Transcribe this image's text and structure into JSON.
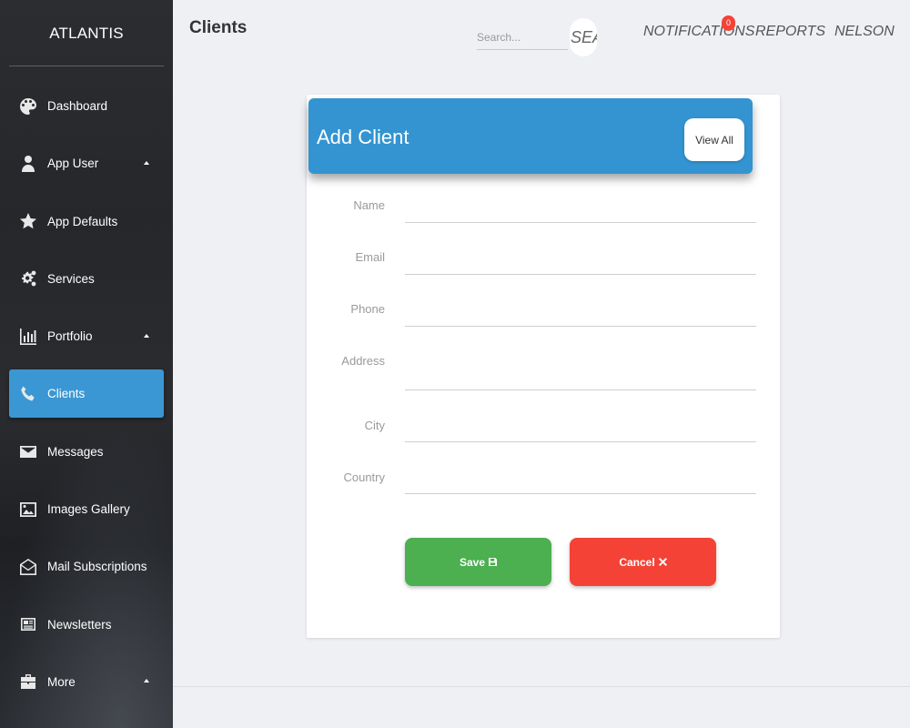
{
  "app": {
    "brand": "ATLANTIS"
  },
  "topbar": {
    "page_title": "Clients",
    "search": {
      "placeholder": "Search...",
      "button_label": "SEARCH"
    },
    "notifications": {
      "label": "NOTIFICATIONS",
      "count": "0"
    },
    "reports": "REPORTS",
    "user": "NELSON"
  },
  "sidebar": {
    "items": [
      {
        "label": "Dashboard",
        "icon": "palette-icon"
      },
      {
        "label": "App User",
        "icon": "person-icon",
        "expandable": true
      },
      {
        "label": "App Defaults",
        "icon": "star-icon"
      },
      {
        "label": "Services",
        "icon": "gears-icon"
      },
      {
        "label": "Portfolio",
        "icon": "bar-chart-icon",
        "expandable": true
      },
      {
        "label": "Clients",
        "icon": "phone-icon",
        "active": true
      },
      {
        "label": "Messages",
        "icon": "envelope-icon"
      },
      {
        "label": "Images Gallery",
        "icon": "image-icon"
      },
      {
        "label": "Mail Subscriptions",
        "icon": "open-envelope-icon"
      },
      {
        "label": "Newsletters",
        "icon": "newspaper-icon"
      },
      {
        "label": "More",
        "icon": "briefcase-icon",
        "expandable": true
      }
    ]
  },
  "form": {
    "title": "Add Client",
    "view_all": "View All",
    "fields": {
      "name": {
        "label": "Name",
        "value": ""
      },
      "email": {
        "label": "Email",
        "value": ""
      },
      "phone": {
        "label": "Phone",
        "value": ""
      },
      "address": {
        "label": "Address",
        "value": ""
      },
      "city": {
        "label": "City",
        "value": ""
      },
      "country": {
        "label": "Country",
        "value": ""
      }
    },
    "save_label": "Save",
    "cancel_label": "Cancel"
  },
  "colors": {
    "accent": "#3394d1",
    "active_nav": "#3b97d3",
    "save": "#4caf50",
    "cancel": "#f44336",
    "badge": "#f44336"
  }
}
